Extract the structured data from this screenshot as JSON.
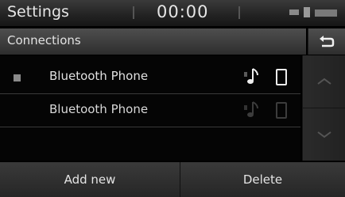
{
  "status_bar": {
    "title": "Settings",
    "clock": "00:00",
    "indicator_icons": [
      "battery-icon",
      "bluetooth-icon",
      "signal-icon"
    ]
  },
  "header": {
    "label": "Connections",
    "back_icon": "back-arrow-icon"
  },
  "devices": [
    {
      "name": "Bluetooth Phone",
      "connected": true,
      "audio_icon": "music-note-icon",
      "phone_icon": "phone-icon"
    },
    {
      "name": "Bluetooth Phone",
      "connected": false,
      "audio_icon": "music-note-icon",
      "phone_icon": "phone-icon"
    }
  ],
  "scroll": {
    "up_icon": "chevron-up-icon",
    "down_icon": "chevron-down-icon"
  },
  "buttons": {
    "add_new": "Add new",
    "delete": "Delete"
  },
  "colors": {
    "background": "#000000",
    "text": "#e0e0e0",
    "active_icon": "#eeeeee",
    "inactive_icon": "#3c3c3c"
  }
}
